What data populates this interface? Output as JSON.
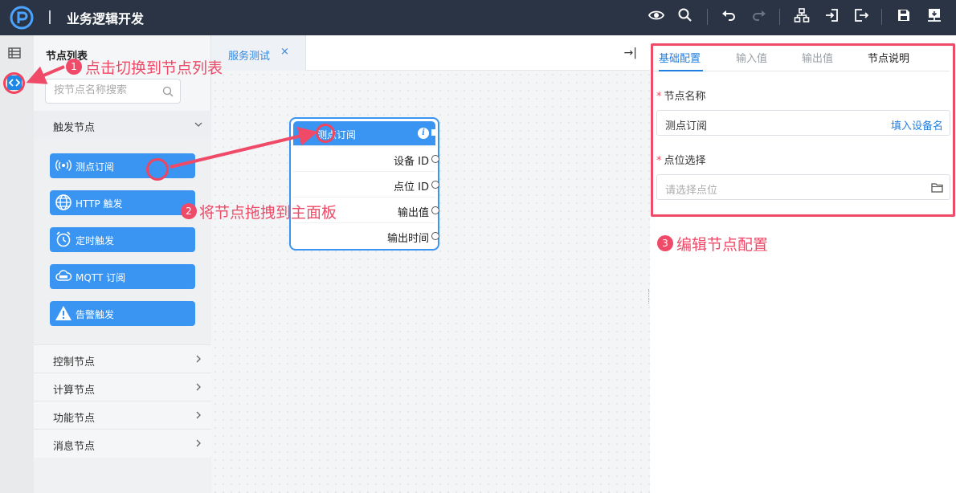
{
  "app": {
    "title": "业务逻辑开发"
  },
  "toolbar": {
    "icons": [
      "eye-icon",
      "search-icon",
      "undo-icon",
      "redo-icon",
      "sitemap-icon",
      "import-icon",
      "export-icon",
      "save-icon",
      "deploy-icon"
    ]
  },
  "left_panel": {
    "title": "节点列表",
    "search_placeholder": "按节点名称搜索",
    "open_category": "触发节点",
    "nodes": [
      {
        "label": "测点订阅",
        "icon": "broadcast-icon"
      },
      {
        "label": "HTTP 触发",
        "icon": "globe-icon"
      },
      {
        "label": "定时触发",
        "icon": "alarm-clock-icon"
      },
      {
        "label": "MQTT 订阅",
        "icon": "mqtt-cloud-icon"
      },
      {
        "label": "告警触发",
        "icon": "warning-icon"
      }
    ],
    "categories": [
      "控制节点",
      "计算节点",
      "功能节点",
      "消息节点"
    ]
  },
  "tabs": [
    {
      "label": "服务测试",
      "close": "×"
    }
  ],
  "collapse_label": "→|",
  "canvas_node": {
    "title": "测点订阅",
    "info": "i",
    "rows": [
      "设备 ID",
      "点位 ID",
      "输出值",
      "输出时间"
    ]
  },
  "right_panel": {
    "tabs": [
      "基础配置",
      "输入值",
      "输出值",
      "节点说明"
    ],
    "fields": {
      "name_label": "节点名称",
      "name_value": "测点订阅",
      "name_action": "填入设备名",
      "point_label": "点位选择",
      "point_placeholder": "请选择点位"
    }
  },
  "annotations": [
    {
      "num": "1",
      "text": "点击切换到节点列表"
    },
    {
      "num": "2",
      "text": "将节点拖拽到主面板"
    },
    {
      "num": "3",
      "text": "编辑节点配置"
    }
  ],
  "colors": {
    "accent": "#3a95f2",
    "annotation": "#ef4a67",
    "topbar": "#2a3444"
  }
}
